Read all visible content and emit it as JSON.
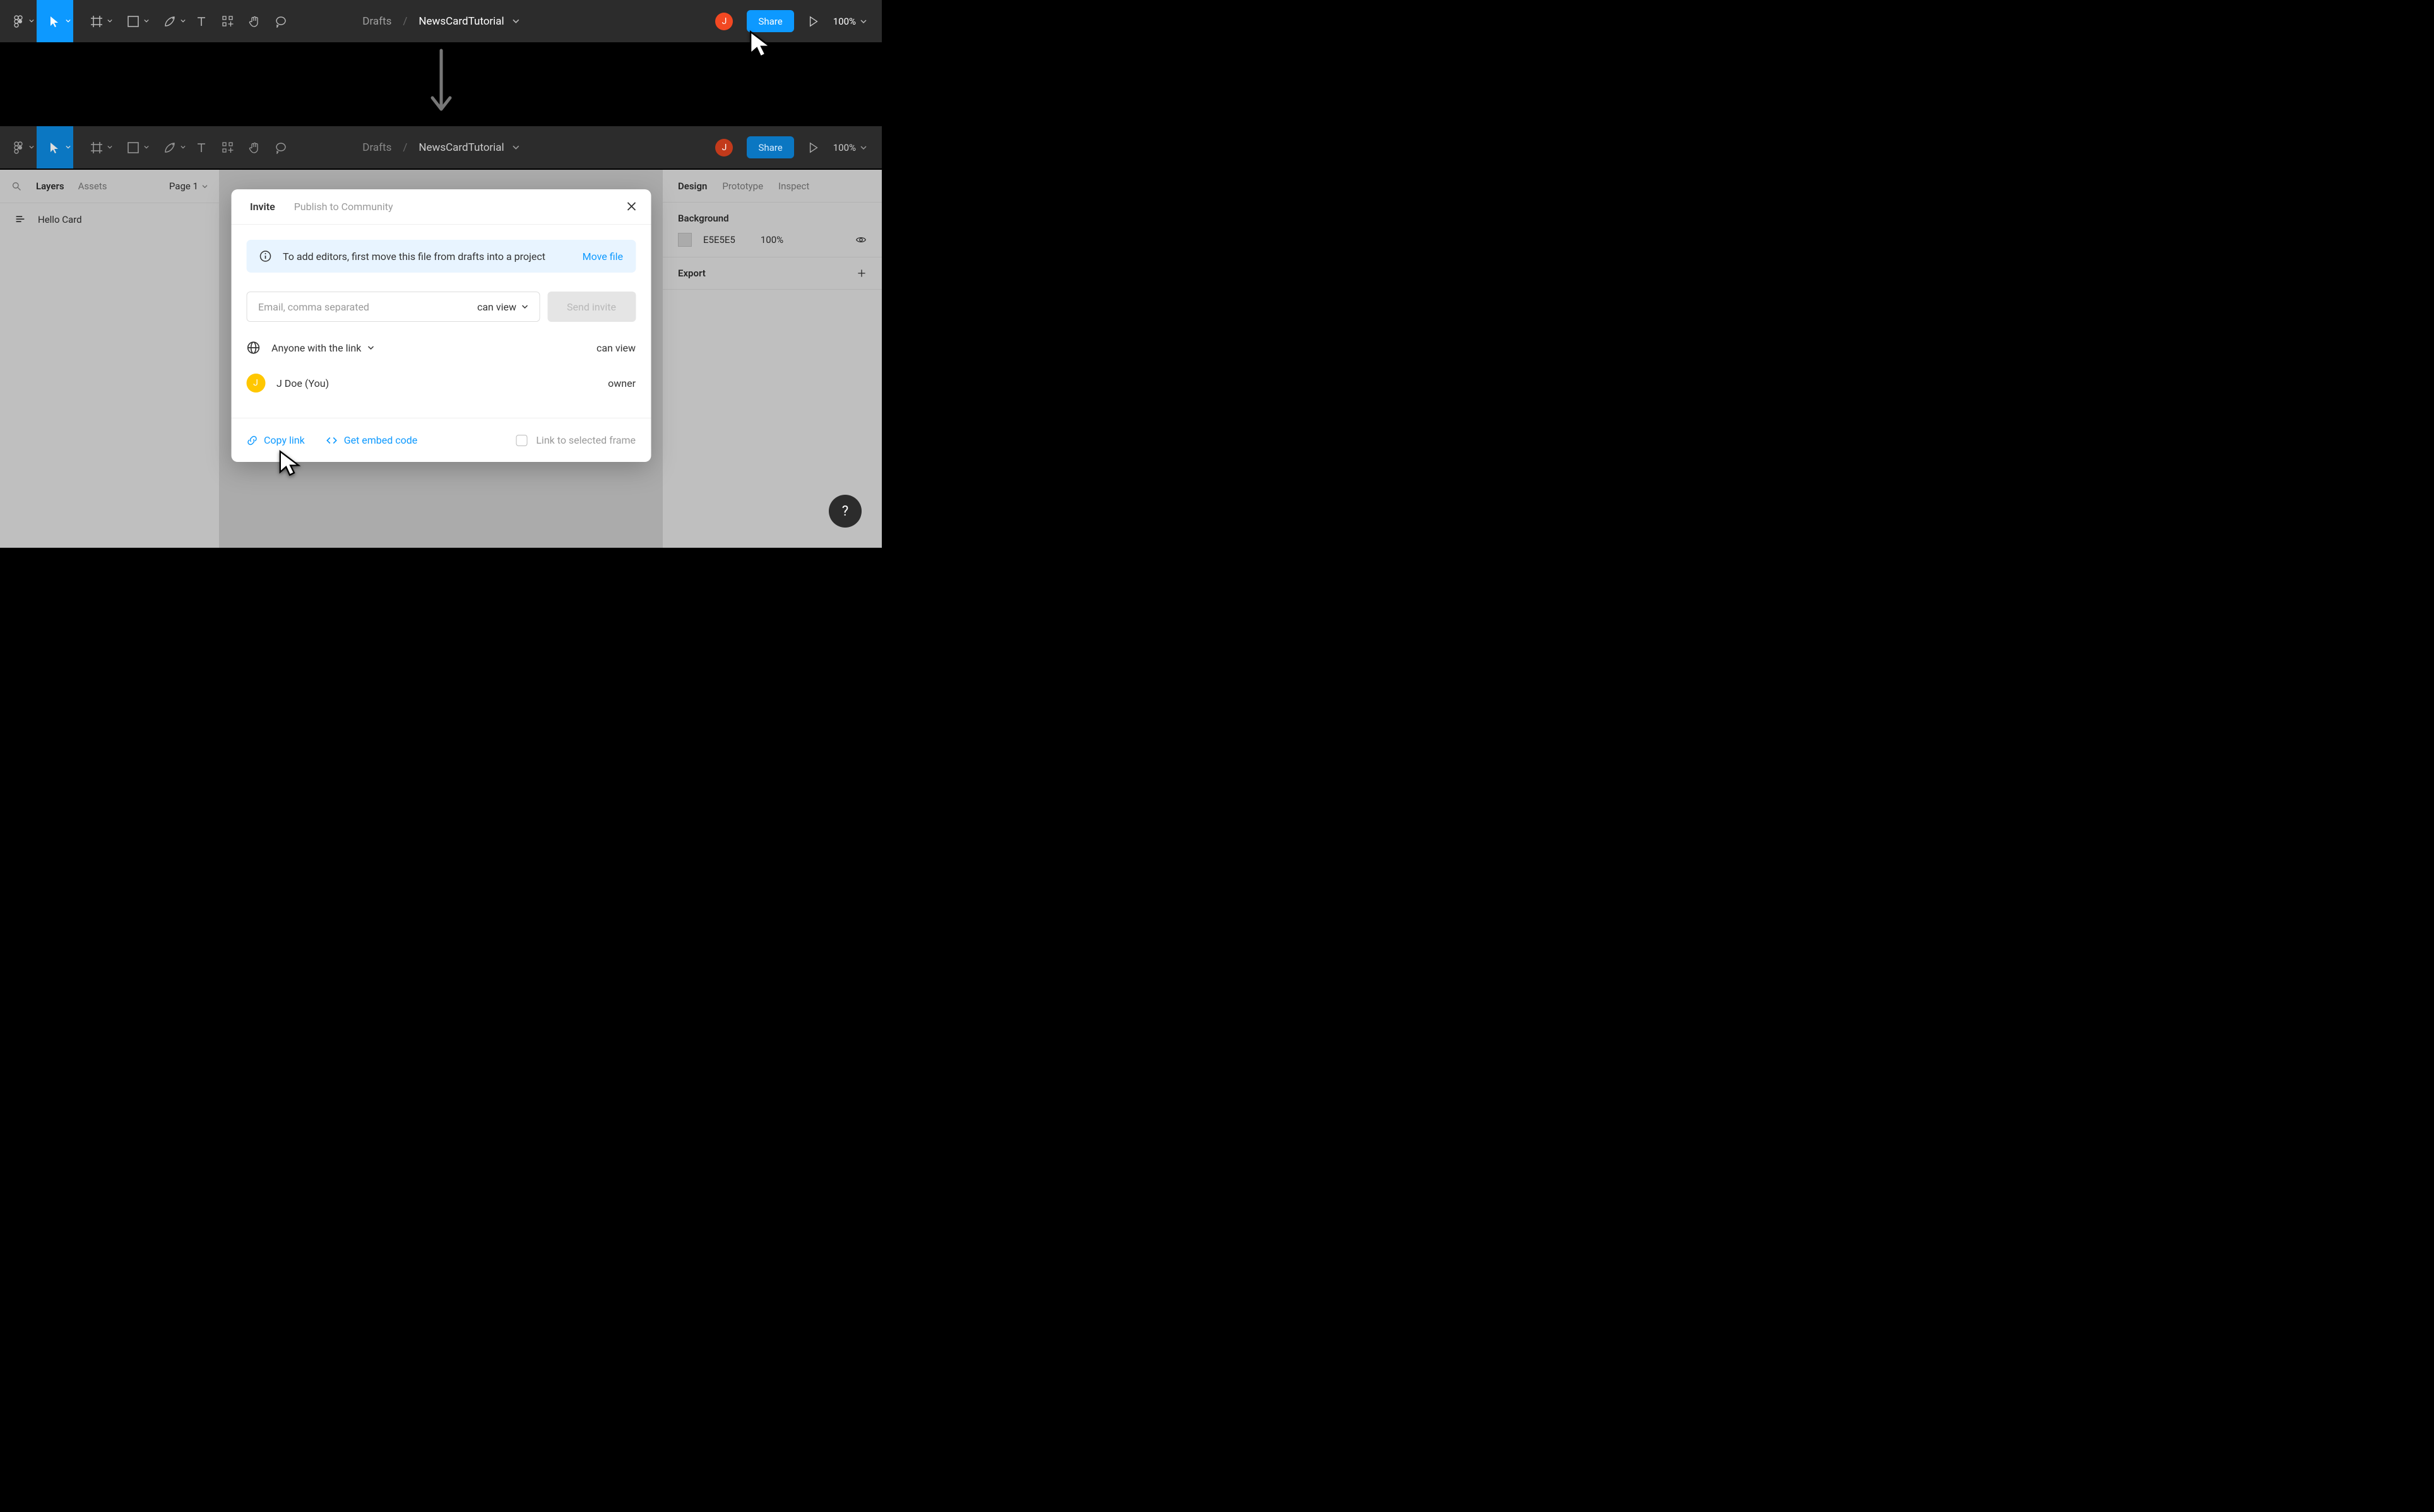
{
  "toolbar": {
    "breadcrumb_section": "Drafts",
    "breadcrumb_file": "NewsCardTutorial",
    "avatar_initial": "J",
    "share_label": "Share",
    "zoom_label": "100%"
  },
  "left_panel": {
    "tabs": {
      "layers": "Layers",
      "assets": "Assets"
    },
    "page_label": "Page 1",
    "layer_name": "Hello Card"
  },
  "right_panel": {
    "tabs": {
      "design": "Design",
      "prototype": "Prototype",
      "inspect": "Inspect"
    },
    "background": {
      "title": "Background",
      "hex": "E5E5E5",
      "opacity": "100%"
    },
    "export_title": "Export"
  },
  "share_modal": {
    "tabs": {
      "invite": "Invite",
      "publish": "Publish to Community"
    },
    "info_message": "To add editors, first move this file from drafts into a project",
    "move_file": "Move file",
    "email_placeholder": "Email, comma separated",
    "permission_default": "can view",
    "send_label": "Send invite",
    "anyone_label": "Anyone with the link",
    "anyone_permission": "can view",
    "owner_avatar_initial": "J",
    "owner_name": "J Doe (You)",
    "owner_role": "owner",
    "copy_link": "Copy link",
    "embed_code": "Get embed code",
    "link_to_frame": "Link to selected frame"
  },
  "help_label": "?"
}
